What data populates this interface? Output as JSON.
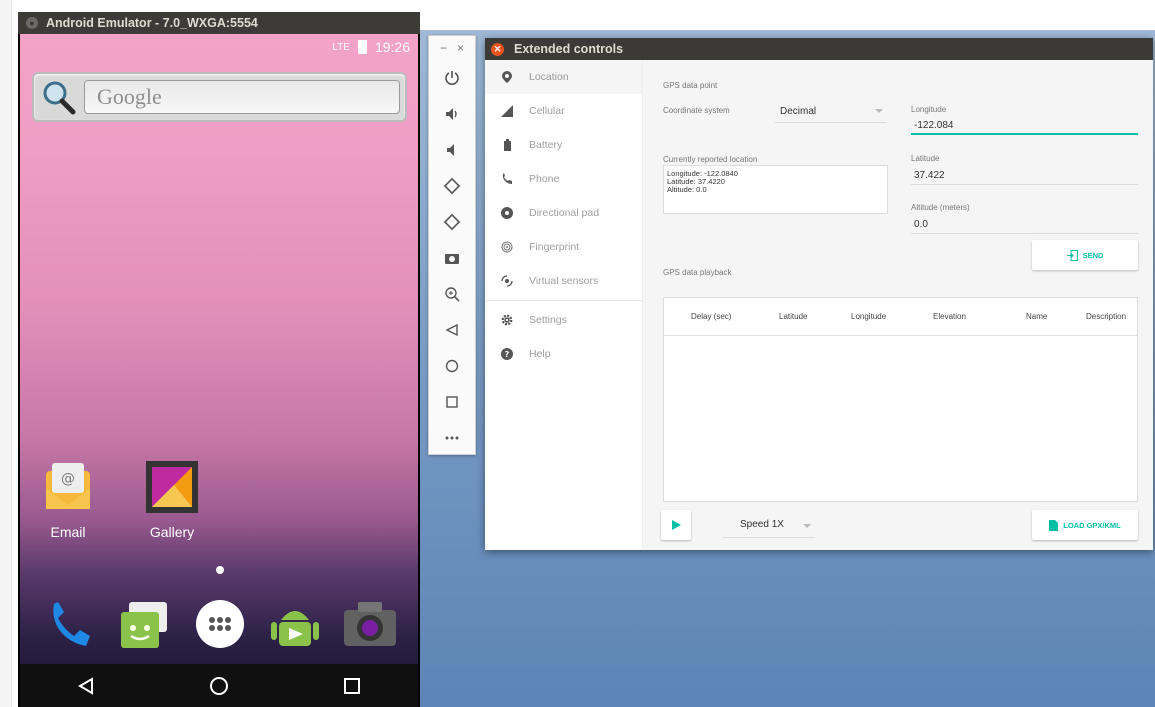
{
  "emulator": {
    "title": "Android Emulator - 7.0_WXGA:5554",
    "status_time": "19:26",
    "status_signal": "LTE",
    "search_placeholder": "Google",
    "apps": [
      {
        "label": "Email",
        "icon": "email-icon"
      },
      {
        "label": "Gallery",
        "icon": "gallery-icon"
      }
    ],
    "dock": [
      "phone-icon",
      "messaging-icon",
      "app-drawer-icon",
      "play-store-icon",
      "camera-icon"
    ],
    "nav": [
      "back-icon",
      "home-icon",
      "recents-icon"
    ]
  },
  "toolbar": {
    "minimize": "−",
    "close": "×",
    "buttons": [
      "power-icon",
      "volume-up-icon",
      "volume-down-icon",
      "rotate-left-icon",
      "rotate-right-icon",
      "screenshot-icon",
      "zoom-icon",
      "back-icon",
      "home-icon",
      "overview-icon",
      "more-icon"
    ]
  },
  "extended": {
    "title": "Extended controls",
    "nav": [
      {
        "label": "Location",
        "icon": "location-pin-icon",
        "active": true
      },
      {
        "label": "Cellular",
        "icon": "signal-icon"
      },
      {
        "label": "Battery",
        "icon": "battery-icon"
      },
      {
        "label": "Phone",
        "icon": "phone-icon"
      },
      {
        "label": "Directional pad",
        "icon": "dpad-icon"
      },
      {
        "label": "Fingerprint",
        "icon": "fingerprint-icon"
      },
      {
        "label": "Virtual sensors",
        "icon": "sensors-icon"
      },
      {
        "label": "Settings",
        "icon": "gear-icon"
      },
      {
        "label": "Help",
        "icon": "help-icon"
      }
    ],
    "location": {
      "gps_point_heading": "GPS data point",
      "coord_system_label": "Coordinate system",
      "coord_system_value": "Decimal",
      "longitude_label": "Longitude",
      "longitude_value": "-122.084",
      "latitude_label": "Latitude",
      "latitude_value": "37.422",
      "altitude_label": "Altitude (meters)",
      "altitude_value": "0.0",
      "current_location_label": "Currently reported location",
      "current_location_lines": [
        "Longitude: -122.0840",
        "Latitude: 37.4220",
        "Altitude: 0.0"
      ],
      "send_label": "SEND",
      "playback_heading": "GPS data playback",
      "table_columns": [
        "Delay (sec)",
        "Latitude",
        "Longitude",
        "Elevation",
        "Name",
        "Description"
      ],
      "speed_value": "Speed 1X",
      "load_label": "LOAD GPX/KML"
    },
    "accent_color": "#00bfa5"
  }
}
